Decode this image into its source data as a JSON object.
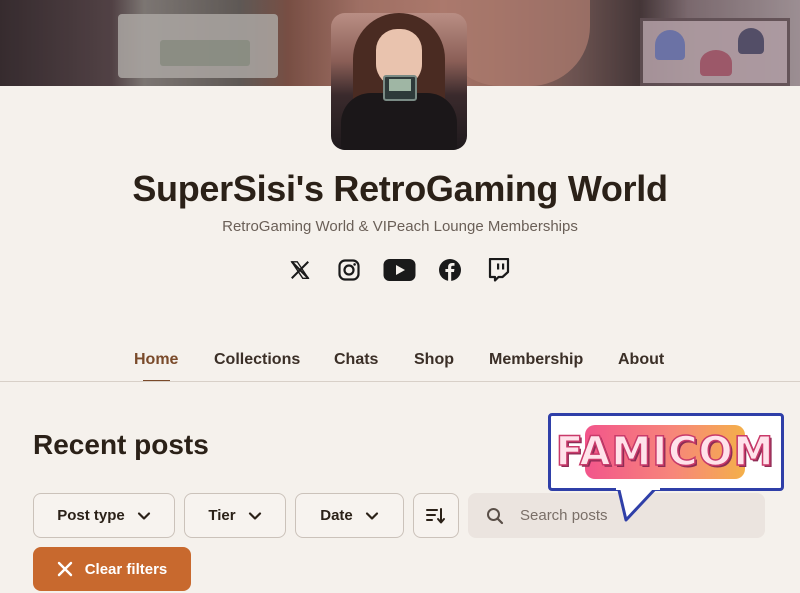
{
  "creator": {
    "title": "SuperSisi's RetroGaming World",
    "subtitle": "RetroGaming World & VIPeach Lounge Memberships"
  },
  "social_links": [
    {
      "icon": "x-icon"
    },
    {
      "icon": "instagram-icon"
    },
    {
      "icon": "youtube-icon"
    },
    {
      "icon": "facebook-icon"
    },
    {
      "icon": "twitch-icon"
    }
  ],
  "nav": {
    "items": [
      {
        "label": "Home",
        "active": true
      },
      {
        "label": "Collections",
        "active": false
      },
      {
        "label": "Chats",
        "active": false
      },
      {
        "label": "Shop",
        "active": false
      },
      {
        "label": "Membership",
        "active": false
      },
      {
        "label": "About",
        "active": false
      }
    ]
  },
  "posts": {
    "heading": "Recent posts",
    "filters": [
      {
        "label": "Post type",
        "icon": "chevron-down-icon"
      },
      {
        "label": "Tier",
        "icon": "chevron-down-icon"
      },
      {
        "label": "Date",
        "icon": "chevron-down-icon"
      }
    ],
    "sort_icon": "sort-icon",
    "search": {
      "placeholder": "Search posts",
      "value": ""
    },
    "clear_filters": "Clear filters"
  },
  "sticker": {
    "text": "FAMICOM"
  },
  "colors": {
    "background": "#f5f1ec",
    "accent": "#c8692e",
    "active_nav": "#7a4a2a",
    "sticker_border": "#2f3fa8",
    "sticker_fill": "#f2558b"
  }
}
